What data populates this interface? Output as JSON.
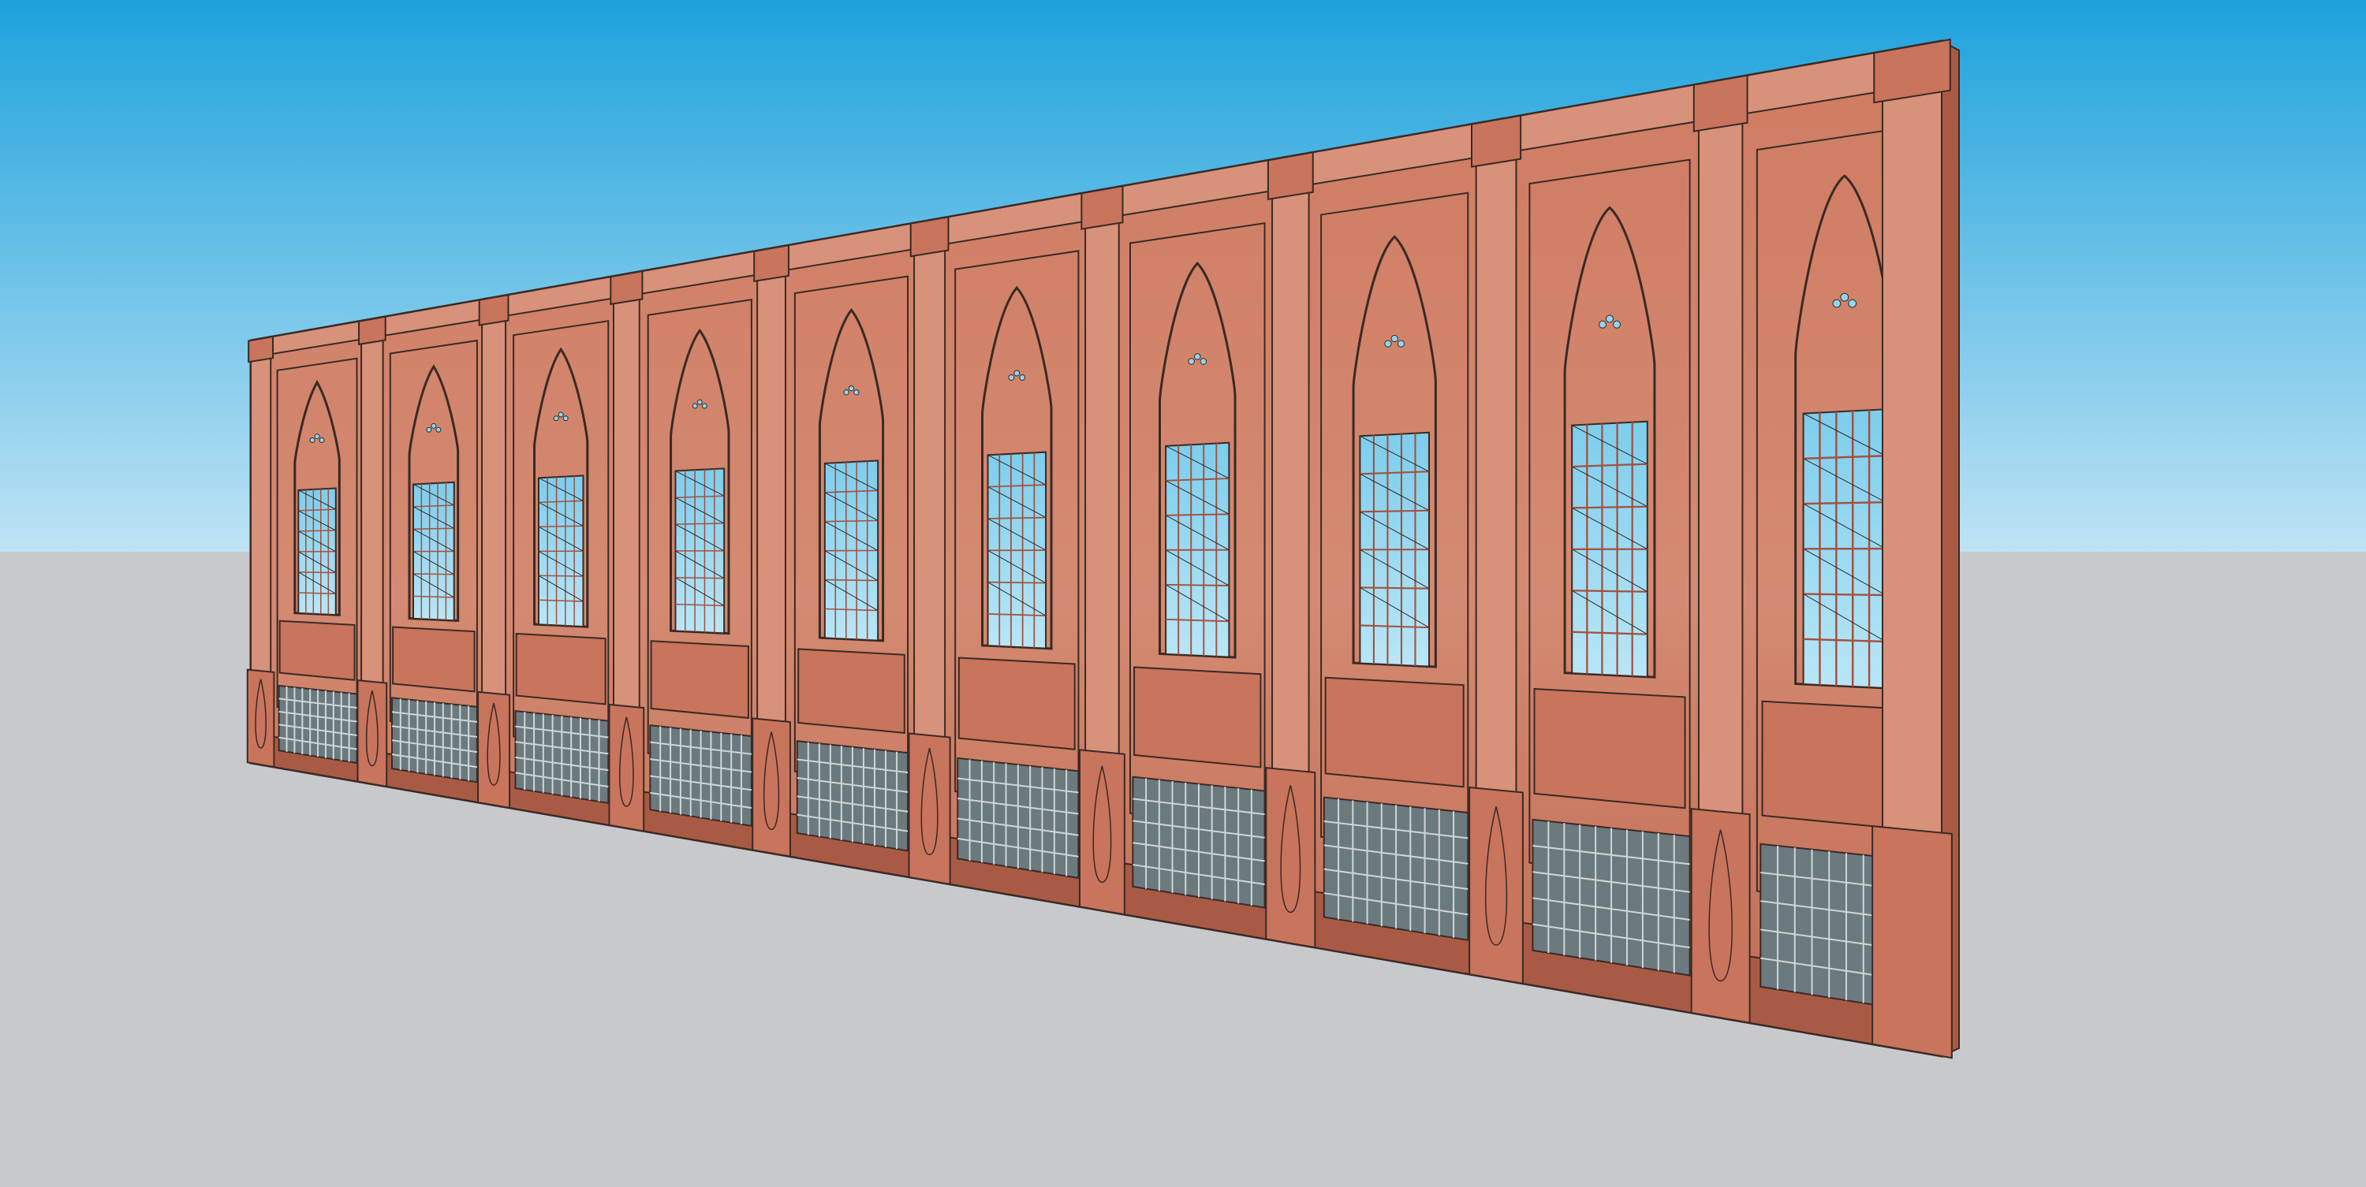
{
  "scene": {
    "kind": "3d-model-viewport",
    "sky_top_color": "#1da2dc",
    "sky_bottom_color": "#bfe3f4",
    "ground_color": "#c8c9cd",
    "stone_color": "#c9745d",
    "stone_light_color": "#d8917a",
    "stone_dark_color": "#a95a45",
    "outline_color": "#3a2a24",
    "lattice_color": "#6b7a7f",
    "jali_opening_color": "#8fd6f0",
    "bay_count": 10,
    "style": "red sandstone wall with mughal arch windows, jali screens and lower lattice panels"
  }
}
